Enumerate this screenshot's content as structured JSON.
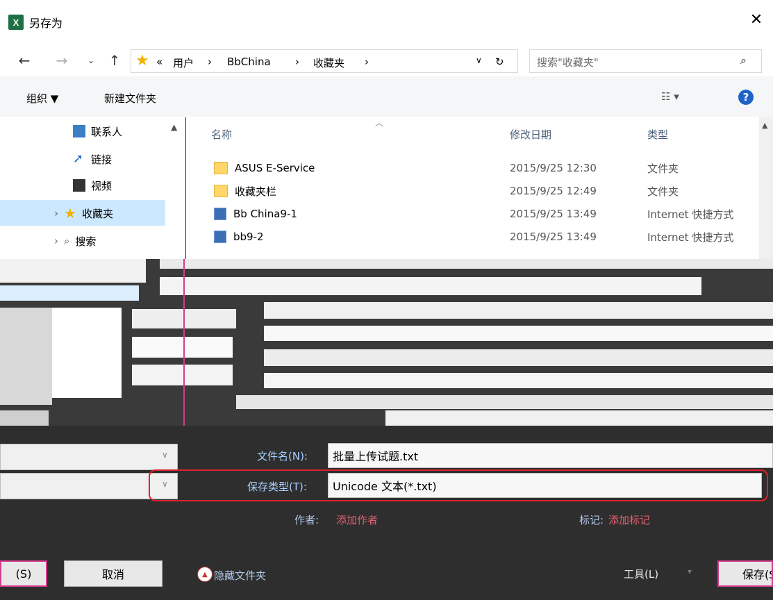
{
  "title": "另存为",
  "app_icon": "X",
  "breadcrumb": {
    "prefix": "«",
    "items": [
      "用户",
      "BbChina",
      "收藏夹"
    ]
  },
  "search": {
    "placeholder": "搜索\"收藏夹\""
  },
  "toolbar": {
    "organize": "组织 ▼",
    "new_folder": "新建文件夹",
    "help": "?"
  },
  "nav": {
    "items": [
      {
        "label": "联系人",
        "icon": "contacts-icon"
      },
      {
        "label": "链接",
        "icon": "links-icon"
      },
      {
        "label": "视频",
        "icon": "videos-icon"
      },
      {
        "label": "收藏夹",
        "icon": "favorites-star-icon",
        "selected": true
      },
      {
        "label": "搜索",
        "icon": "search-icon"
      }
    ]
  },
  "columns": {
    "name": "名称",
    "date": "修改日期",
    "type": "类型"
  },
  "files": [
    {
      "name": "ASUS E-Service",
      "date": "2015/9/25 12:30",
      "type": "文件夹",
      "kind": "folder"
    },
    {
      "name": "收藏夹栏",
      "date": "2015/9/25 12:49",
      "type": "文件夹",
      "kind": "folder"
    },
    {
      "name": "Bb China9-1",
      "date": "2015/9/25 13:49",
      "type": "Internet 快捷方式",
      "kind": "url"
    },
    {
      "name": "bb9-2",
      "date": "2015/9/25 13:49",
      "type": "Internet 快捷方式",
      "kind": "url"
    }
  ],
  "form": {
    "filename_label": "文件名(N):",
    "filename_value": "批量上传试题.txt",
    "savetype_label": "保存类型(T):",
    "savetype_value": "Unicode 文本(*.txt)",
    "author_label": "作者:",
    "author_value": "添加作者",
    "tags_label": "标记:",
    "tags_value": "添加标记"
  },
  "buttons": {
    "left_partial": "(S)",
    "cancel": "取消",
    "hide_folders": "隐藏文件夹",
    "tools": "工具(L)",
    "save": "保存(S)"
  }
}
